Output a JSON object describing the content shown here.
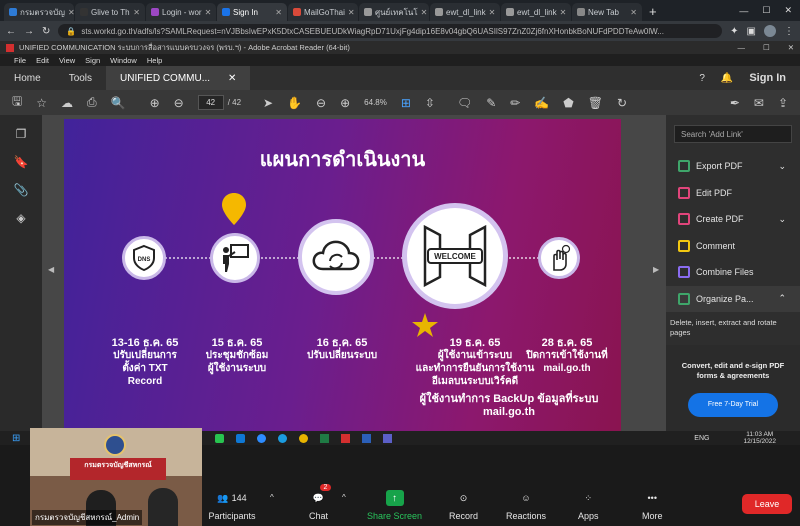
{
  "browser": {
    "tabs": [
      {
        "label": "กรมตรวจบัญ",
        "color": "#2e7bd6"
      },
      {
        "label": "Glive to Th",
        "color": "#333333"
      },
      {
        "label": "Login - wor",
        "color": "#9c47c4"
      },
      {
        "label": "Sign In",
        "color": "#1a73e8"
      },
      {
        "label": "MailGoThai",
        "color": "#d94a3a"
      },
      {
        "label": "ศูนย์เทคโนโ",
        "color": "#999999"
      },
      {
        "label": "ewt_dl_link",
        "color": "#999999"
      },
      {
        "label": "ewt_dl_link",
        "color": "#999999"
      },
      {
        "label": "New Tab",
        "color": "#888888"
      }
    ],
    "url": "sts.workd.go.th/adfs/ls?SAMLRequest=nVJBbsIwEPxK5DtxCASEBUEUDkWiagRpD71UxjFg4dip16E8v04gbQ6UASIlS97ZnZ0Zj6fnXHonbkBoNUFdPDDTeAw0lW..."
  },
  "acrobat": {
    "title": "UNIFIED COMMUNICATION ระบบการสื่อสารแบบครบวงจร (พรบ.ฯ) - Adobe Acrobat Reader (64-bit)",
    "menu": [
      "File",
      "Edit",
      "View",
      "Sign",
      "Window",
      "Help"
    ],
    "tabs": {
      "home": "Home",
      "tools": "Tools",
      "doc": "UNIFIED COMMU..."
    },
    "sign_in": "Sign In",
    "page_current": "42",
    "page_total": "/ 42",
    "zoom": "64.8%",
    "search_placeholder": "Search 'Add Link'",
    "tools": [
      {
        "label": "Export PDF",
        "color": "#3fa56a",
        "chevron": "⌄"
      },
      {
        "label": "Edit PDF",
        "color": "#e0457b",
        "chevron": ""
      },
      {
        "label": "Create PDF",
        "color": "#e0457b",
        "chevron": "⌄"
      },
      {
        "label": "Comment",
        "color": "#f2c811",
        "chevron": ""
      },
      {
        "label": "Combine Files",
        "color": "#8a6cf0",
        "chevron": ""
      },
      {
        "label": "Organize Pa...",
        "color": "#3fa56a",
        "chevron": "⌃"
      }
    ],
    "tooltip": "Delete, insert, extract and rotate pages",
    "promo": "Convert, edit and e-sign PDF forms & agreements",
    "trial": "Free 7-Day Trial"
  },
  "slide": {
    "title": "แผนการดำเนินงาน",
    "steps": [
      {
        "date": "13-16 ธ.ค. 65",
        "desc": [
          "ปรับเปลี่ยนการ",
          "ตั้งค่า TXT",
          "Record"
        ]
      },
      {
        "date": "15 ธ.ค. 65",
        "desc": [
          "ประชุมชักซ้อม",
          "ผู้ใช้งานระบบ"
        ]
      },
      {
        "date": "16 ธ.ค. 65",
        "desc": [
          "ปรับเปลี่ยนระบบ"
        ]
      },
      {
        "date": "19 ธ.ค. 65",
        "desc": [
          "ผู้ใช้งานเข้าระบบ",
          "และทำการยืนยันการใช้งาน",
          "อีเมลบนระบบเวิร์คดี"
        ]
      },
      {
        "date": "28 ธ.ค. 65",
        "desc": [
          "ปิดการเข้าใช้งานที่",
          "mail.go.th"
        ]
      }
    ],
    "dns_label": "DNS",
    "welcome_label": "WELCOME",
    "footer": "ผู้ใช้งานทำการ BackUp ข้อมูลที่ระบบ mail.go.th"
  },
  "taskbar": {
    "lang": "ENG",
    "time": "11:03 AM",
    "date": "12/15/2022"
  },
  "zoom": {
    "participants_count": "144",
    "chat_badge": "2",
    "buttons": [
      "Participants",
      "Chat",
      "Share Screen",
      "Record",
      "Reactions",
      "Apps",
      "More"
    ],
    "leave": "Leave",
    "video_name": "กรมตรวจบัญชีสหกรณ์_Admin",
    "video_banner": "กรมตรวจบัญชีสหกรณ์"
  }
}
